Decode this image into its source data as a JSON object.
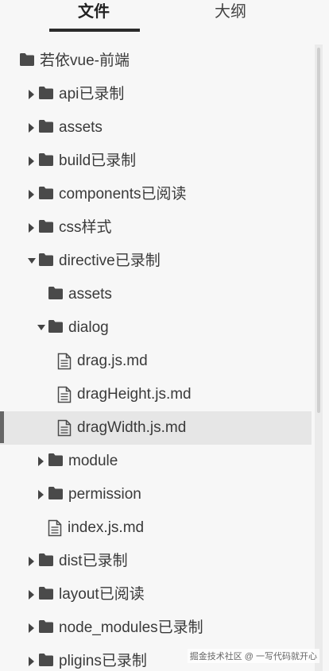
{
  "tabs": {
    "files_label": "文件",
    "outline_label": "大纲"
  },
  "tree": [
    {
      "label": "若依vue-前端",
      "type": "folder",
      "depth": 0,
      "arrow": "none",
      "icon": "folder-icon"
    },
    {
      "label": "api已录制",
      "type": "folder",
      "depth": 1,
      "arrow": "right",
      "icon": "folder-icon"
    },
    {
      "label": "assets",
      "type": "folder",
      "depth": 1,
      "arrow": "right",
      "icon": "folder-icon"
    },
    {
      "label": "build已录制",
      "type": "folder",
      "depth": 1,
      "arrow": "right",
      "icon": "folder-icon"
    },
    {
      "label": "components已阅读",
      "type": "folder",
      "depth": 1,
      "arrow": "right",
      "icon": "folder-icon"
    },
    {
      "label": "css样式",
      "type": "folder",
      "depth": 1,
      "arrow": "right",
      "icon": "folder-icon"
    },
    {
      "label": "directive已录制",
      "type": "folder",
      "depth": 1,
      "arrow": "down",
      "icon": "folder-icon"
    },
    {
      "label": "assets",
      "type": "folder",
      "depth": 2,
      "arrow": "none",
      "icon": "folder-icon"
    },
    {
      "label": "dialog",
      "type": "folder",
      "depth": 2,
      "arrow": "down",
      "icon": "folder-icon"
    },
    {
      "label": "drag.js.md",
      "type": "file",
      "depth": 3,
      "arrow": "none",
      "icon": "document-icon"
    },
    {
      "label": "dragHeight.js.md",
      "type": "file",
      "depth": 3,
      "arrow": "none",
      "icon": "document-icon"
    },
    {
      "label": "dragWidth.js.md",
      "type": "file",
      "depth": 3,
      "arrow": "none",
      "icon": "document-icon",
      "selected": true
    },
    {
      "label": "module",
      "type": "folder",
      "depth": 2,
      "arrow": "right",
      "icon": "folder-icon"
    },
    {
      "label": "permission",
      "type": "folder",
      "depth": 2,
      "arrow": "right",
      "icon": "folder-icon"
    },
    {
      "label": "index.js.md",
      "type": "file",
      "depth": 2,
      "arrow": "none",
      "icon": "document-icon"
    },
    {
      "label": "dist已录制",
      "type": "folder",
      "depth": 1,
      "arrow": "right",
      "icon": "folder-icon"
    },
    {
      "label": "layout已阅读",
      "type": "folder",
      "depth": 1,
      "arrow": "right",
      "icon": "folder-icon"
    },
    {
      "label": "node_modules已录制",
      "type": "folder",
      "depth": 1,
      "arrow": "right",
      "icon": "folder-icon"
    },
    {
      "label": "pligins已录制",
      "type": "folder",
      "depth": 1,
      "arrow": "right",
      "icon": "folder-icon"
    }
  ],
  "watermark": "掘金技术社区 @ 一写代码就开心",
  "colors": {
    "background": "#f7f7f7",
    "selected_row": "#e6e6e6",
    "icon": "#4a4a4a",
    "tab_underline": "#2b2b2b"
  }
}
